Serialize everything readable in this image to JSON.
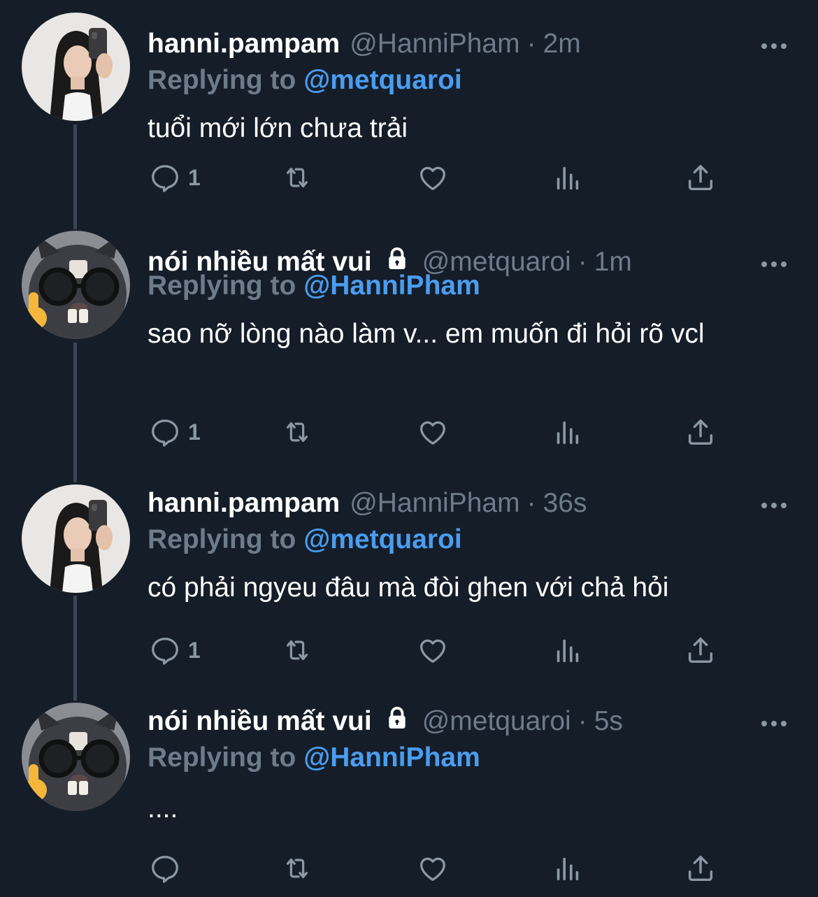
{
  "colors": {
    "background": "#151d28",
    "name": "#ffffff",
    "muted": "#6e7b8b",
    "link": "#4a9df0",
    "thread_line": "#3b4452"
  },
  "icons": {
    "reply": "reply-icon",
    "retweet": "retweet-icon",
    "like": "like-icon",
    "views": "views-icon",
    "share": "share-icon",
    "more": "more-icon",
    "lock": "lock-icon"
  },
  "tweets": [
    {
      "display_name": "hanni.pampam",
      "handle": "@HanniPham",
      "separator": "·",
      "time": "2m",
      "protected": false,
      "reply_prefix": "Replying to",
      "reply_to": "@metquaroi",
      "text": "tuổi mới lớn chưa trải",
      "reply_count": "1"
    },
    {
      "display_name": "nói nhiều mất vui",
      "handle": "@metquaroi",
      "separator": "·",
      "time": "1m",
      "protected": true,
      "reply_prefix": "Replying to",
      "reply_to": "@HanniPham",
      "text": "sao nỡ lòng nào làm v... em muốn đi hỏi rõ vcl",
      "reply_count": "1"
    },
    {
      "display_name": "hanni.pampam",
      "handle": "@HanniPham",
      "separator": "·",
      "time": "36s",
      "protected": false,
      "reply_prefix": "Replying to",
      "reply_to": "@metquaroi",
      "text": "có phải ngyeu đâu mà đòi ghen với chả hỏi",
      "reply_count": "1"
    },
    {
      "display_name": "nói nhiều mất vui",
      "handle": "@metquaroi",
      "separator": "·",
      "time": "5s",
      "protected": true,
      "reply_prefix": "Replying to",
      "reply_to": "@HanniPham",
      "text": "....",
      "reply_count": ""
    }
  ]
}
